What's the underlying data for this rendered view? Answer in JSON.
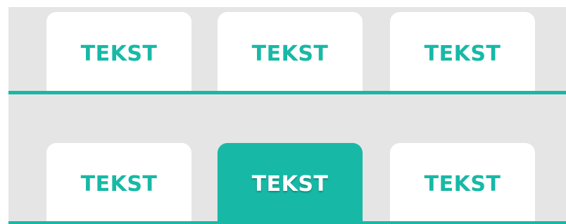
{
  "theme": {
    "accent": "#17b9a6",
    "background": "#e5e5e5",
    "tab_bg": "#ffffff",
    "active_label_color": "#ffffff"
  },
  "tab_bars": [
    {
      "tabs": [
        {
          "label": "TEKST",
          "active": false
        },
        {
          "label": "TEKST",
          "active": false
        },
        {
          "label": "TEKST",
          "active": false
        }
      ]
    },
    {
      "tabs": [
        {
          "label": "TEKST",
          "active": false
        },
        {
          "label": "TEKST",
          "active": true
        },
        {
          "label": "TEKST",
          "active": false
        }
      ]
    }
  ]
}
